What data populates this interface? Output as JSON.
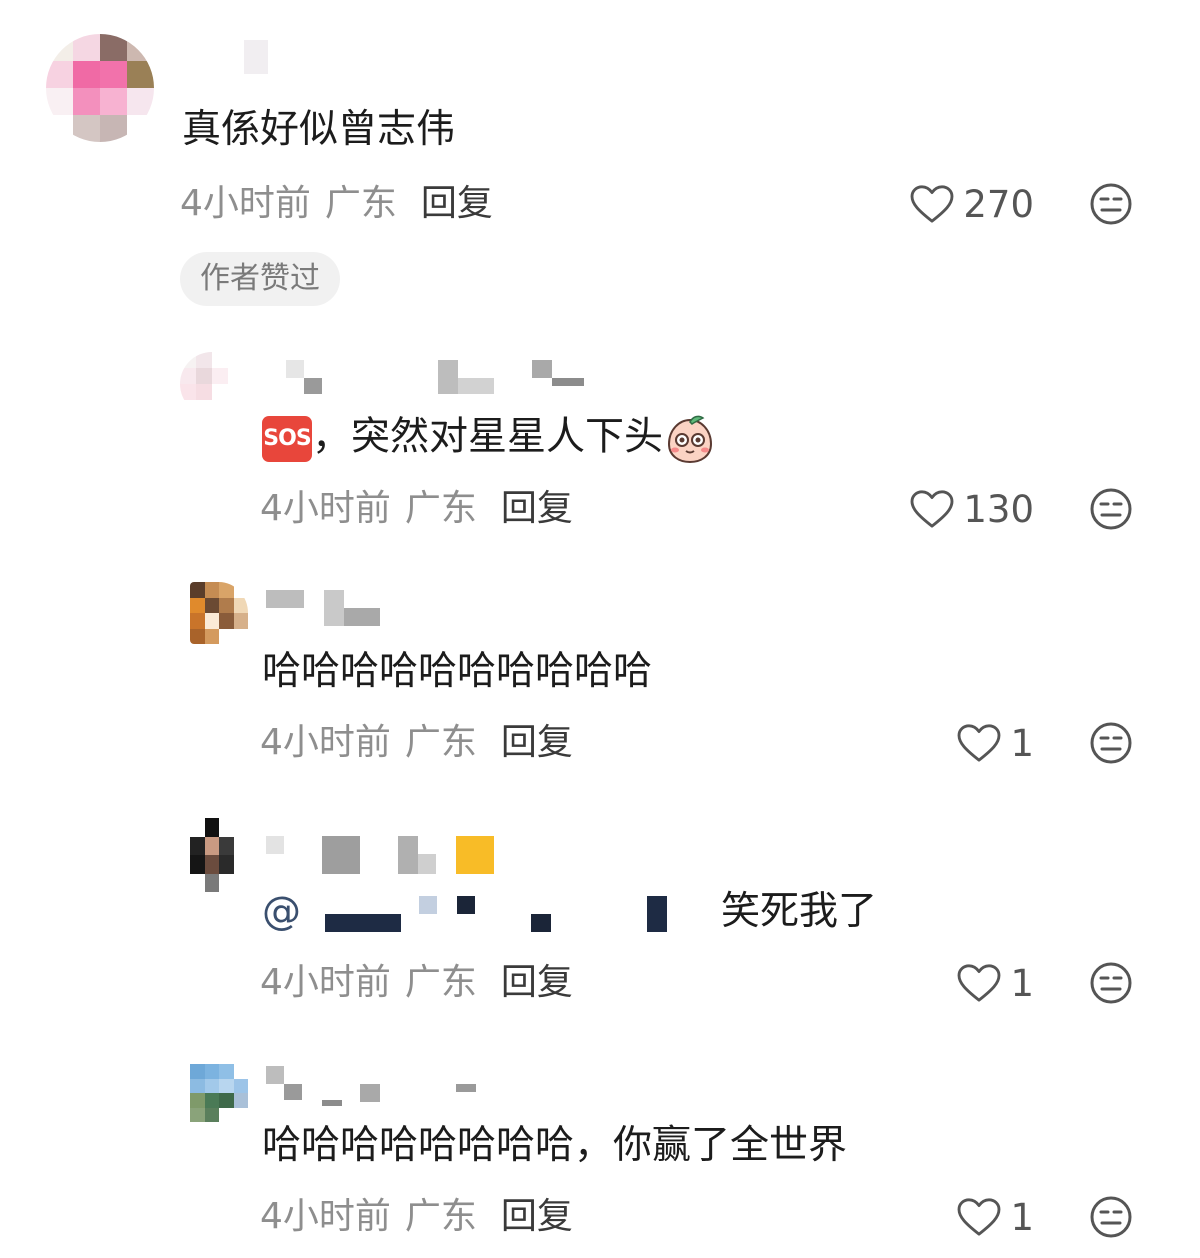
{
  "comments": [
    {
      "text": "真係好似曾志伟",
      "time": "4小时前",
      "location": "广东",
      "reply_label": "回复",
      "likes": "270",
      "badge": "作者赞过"
    },
    {
      "text_after_emoji": "，突然对星星人下头",
      "time": "4小时前",
      "location": "广东",
      "reply_label": "回复",
      "likes": "130",
      "emoji_start": "sos-emoji",
      "emoji_end": "peach-shy-emoji",
      "sos_text": "SOS"
    },
    {
      "text": "哈哈哈哈哈哈哈哈哈哈",
      "time": "4小时前",
      "location": "广东",
      "reply_label": "回复",
      "likes": "1"
    },
    {
      "mention_symbol": "@",
      "text": "笑死我了",
      "time": "4小时前",
      "location": "广东",
      "reply_label": "回复",
      "likes": "1"
    },
    {
      "text": "哈哈哈哈哈哈哈哈，你赢了全世界",
      "time": "4小时前",
      "location": "广东",
      "reply_label": "回复",
      "likes": "1"
    }
  ],
  "icons": {
    "like": "heart-outline-icon",
    "dislike": "meh-face-icon"
  },
  "colors": {
    "meta_text": "#8e8e8e",
    "body_text": "#1c1c1c",
    "icon_stroke": "#555555"
  }
}
